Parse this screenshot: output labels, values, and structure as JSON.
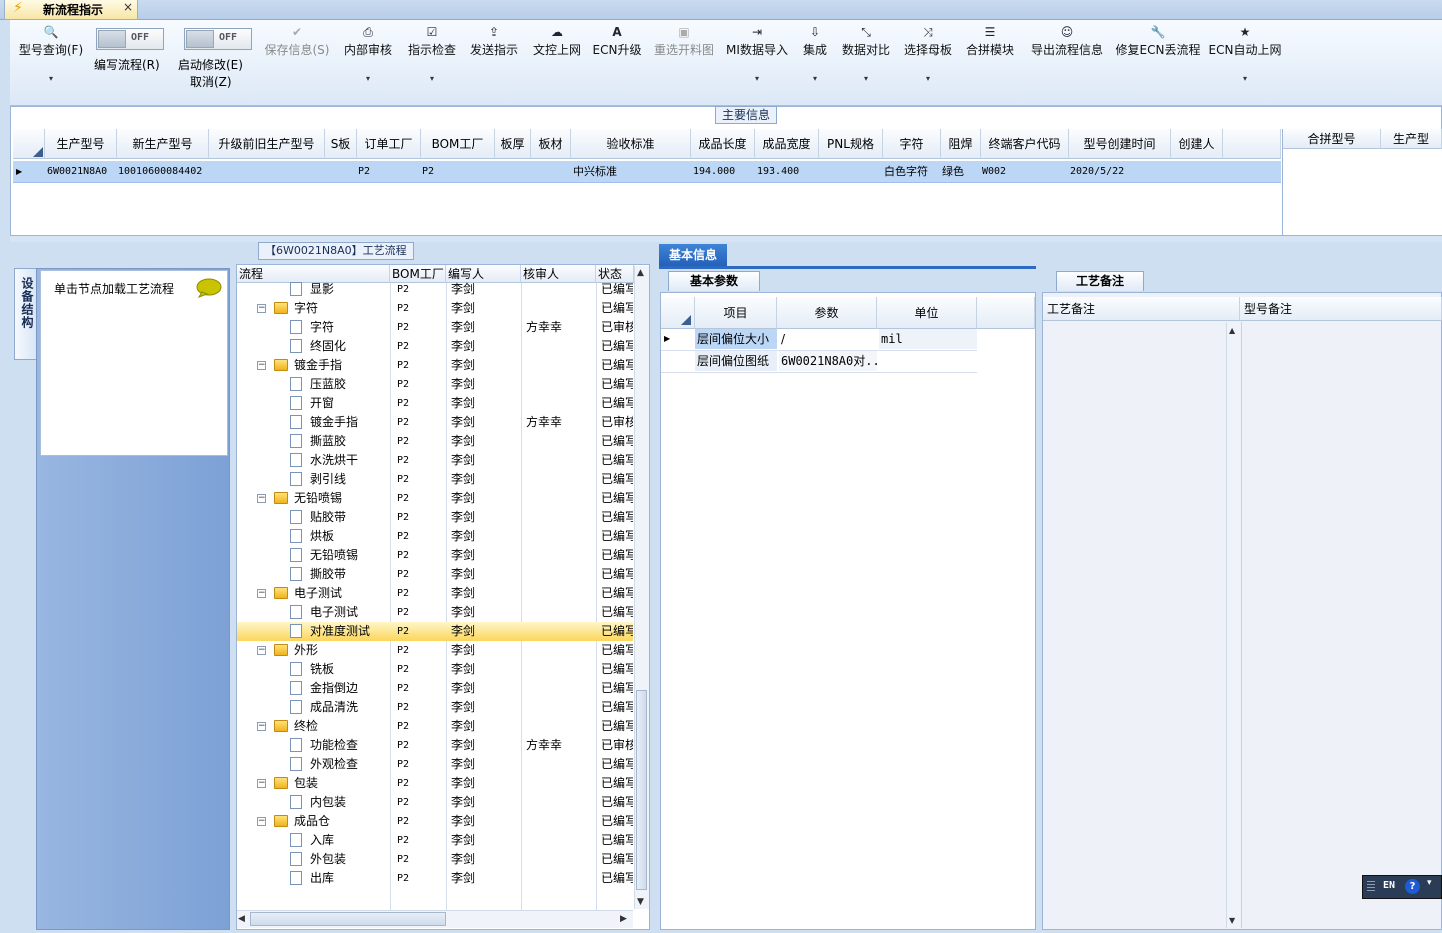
{
  "window": {
    "tab_title": "新流程指示",
    "close_glyph": "×"
  },
  "toolbar": {
    "items": [
      {
        "label": "型号查询(F)",
        "icon": "search-icon",
        "glyph": "🔍"
      },
      {
        "label": "编写流程(R)",
        "toggle": "OFF"
      },
      {
        "label": "启动修改(E)",
        "label2": "取消(Z)",
        "toggle": "OFF"
      },
      {
        "label": "保存信息(S)",
        "icon": "check-icon",
        "glyph": "✔",
        "disabled": true
      },
      {
        "label": "内部审核",
        "icon": "printer-icon",
        "glyph": "⎙"
      },
      {
        "label": "指示检查",
        "icon": "check-box-icon",
        "glyph": "☑"
      },
      {
        "label": "发送指示",
        "icon": "upload-icon",
        "glyph": "⇪"
      },
      {
        "label": "文控上网",
        "icon": "cloud-upload-icon",
        "glyph": "☁"
      },
      {
        "label": "ECN升级",
        "icon": "font-icon",
        "glyph": "A"
      },
      {
        "label": "重选开料图",
        "icon": "image-icon",
        "glyph": "▣",
        "disabled": true
      },
      {
        "label": "MI数据导入",
        "icon": "login-icon",
        "glyph": "⇥"
      },
      {
        "label": "集成",
        "icon": "download-icon",
        "glyph": "⇩"
      },
      {
        "label": "数据对比",
        "icon": "compare-icon",
        "glyph": "⤡"
      },
      {
        "label": "选择母板",
        "icon": "shuffle-icon",
        "glyph": "⤨"
      },
      {
        "label": "合拼模块",
        "icon": "list-icon",
        "glyph": "☰"
      },
      {
        "label": "导出流程信息",
        "icon": "smile-icon",
        "glyph": "☺"
      },
      {
        "label": "修复ECN丢流程",
        "icon": "wrench-icon",
        "glyph": "🔧"
      },
      {
        "label": "ECN自动上网",
        "icon": "star-icon",
        "glyph": "★"
      }
    ]
  },
  "main_info": {
    "caption": "主要信息",
    "columns": [
      "生产型号",
      "新生产型号",
      "升级前旧生产型号",
      "S板",
      "订单工厂",
      "BOM工厂",
      "板厚",
      "板材",
      "验收标准",
      "成品长度",
      "成品宽度",
      "PNL规格",
      "字符",
      "阻焊",
      "终端客户代码",
      "型号创建时间",
      "创建人"
    ],
    "row": {
      "prod_model": "6W0021N8A0",
      "new_model": "10010600084402",
      "order_factory": "P2",
      "bom_factory": "P2",
      "acceptance": "中兴标准",
      "length": "194.000",
      "width": "193.400",
      "char": "白色字符",
      "mask": "绿色",
      "customer": "W002",
      "created": "2020/5/22"
    },
    "side_columns": [
      "合拼型号",
      "生产型"
    ]
  },
  "process_tree": {
    "caption": "【6W0021N8A0】工艺流程",
    "vtab": "设备结构",
    "hint": "单击节点加载工艺流程",
    "columns": [
      "流程",
      "BOM工厂",
      "编写人",
      "核审人",
      "状态"
    ],
    "rows": [
      {
        "name": "显影",
        "level": 1,
        "bom": "P2",
        "writer": "李剑",
        "reviewer": "",
        "status": "已编写"
      },
      {
        "name": "字符",
        "level": 0,
        "bom": "P2",
        "writer": "李剑",
        "reviewer": "",
        "status": "已编写"
      },
      {
        "name": "字符",
        "level": 1,
        "bom": "P2",
        "writer": "李剑",
        "reviewer": "方幸幸",
        "status": "已审核"
      },
      {
        "name": "终固化",
        "level": 1,
        "bom": "P2",
        "writer": "李剑",
        "reviewer": "",
        "status": "已编写"
      },
      {
        "name": "镀金手指",
        "level": 0,
        "bom": "P2",
        "writer": "李剑",
        "reviewer": "",
        "status": "已编写"
      },
      {
        "name": "压蓝胶",
        "level": 1,
        "bom": "P2",
        "writer": "李剑",
        "reviewer": "",
        "status": "已编写"
      },
      {
        "name": "开窗",
        "level": 1,
        "bom": "P2",
        "writer": "李剑",
        "reviewer": "",
        "status": "已编写"
      },
      {
        "name": "镀金手指",
        "level": 1,
        "bom": "P2",
        "writer": "李剑",
        "reviewer": "方幸幸",
        "status": "已审核"
      },
      {
        "name": "撕蓝胶",
        "level": 1,
        "bom": "P2",
        "writer": "李剑",
        "reviewer": "",
        "status": "已编写"
      },
      {
        "name": "水洗烘干",
        "level": 1,
        "bom": "P2",
        "writer": "李剑",
        "reviewer": "",
        "status": "已编写"
      },
      {
        "name": "剥引线",
        "level": 1,
        "bom": "P2",
        "writer": "李剑",
        "reviewer": "",
        "status": "已编写"
      },
      {
        "name": "无铅喷锡",
        "level": 0,
        "bom": "P2",
        "writer": "李剑",
        "reviewer": "",
        "status": "已编写"
      },
      {
        "name": "贴胶带",
        "level": 1,
        "bom": "P2",
        "writer": "李剑",
        "reviewer": "",
        "status": "已编写"
      },
      {
        "name": "烘板",
        "level": 1,
        "bom": "P2",
        "writer": "李剑",
        "reviewer": "",
        "status": "已编写"
      },
      {
        "name": "无铅喷锡",
        "level": 1,
        "bom": "P2",
        "writer": "李剑",
        "reviewer": "",
        "status": "已编写"
      },
      {
        "name": "撕胶带",
        "level": 1,
        "bom": "P2",
        "writer": "李剑",
        "reviewer": "",
        "status": "已编写"
      },
      {
        "name": "电子测试",
        "level": 0,
        "bom": "P2",
        "writer": "李剑",
        "reviewer": "",
        "status": "已编写"
      },
      {
        "name": "电子测试",
        "level": 1,
        "bom": "P2",
        "writer": "李剑",
        "reviewer": "",
        "status": "已编写"
      },
      {
        "name": "对准度测试",
        "level": 1,
        "bom": "P2",
        "writer": "李剑",
        "reviewer": "",
        "status": "已编写",
        "selected": true
      },
      {
        "name": "外形",
        "level": 0,
        "bom": "P2",
        "writer": "李剑",
        "reviewer": "",
        "status": "已编写"
      },
      {
        "name": "铣板",
        "level": 1,
        "bom": "P2",
        "writer": "李剑",
        "reviewer": "",
        "status": "已编写"
      },
      {
        "name": "金指倒边",
        "level": 1,
        "bom": "P2",
        "writer": "李剑",
        "reviewer": "",
        "status": "已编写"
      },
      {
        "name": "成品清洗",
        "level": 1,
        "bom": "P2",
        "writer": "李剑",
        "reviewer": "",
        "status": "已编写"
      },
      {
        "name": "终检",
        "level": 0,
        "bom": "P2",
        "writer": "李剑",
        "reviewer": "",
        "status": "已编写"
      },
      {
        "name": "功能检查",
        "level": 1,
        "bom": "P2",
        "writer": "李剑",
        "reviewer": "方幸幸",
        "status": "已审核"
      },
      {
        "name": "外观检查",
        "level": 1,
        "bom": "P2",
        "writer": "李剑",
        "reviewer": "",
        "status": "已编写"
      },
      {
        "name": "包装",
        "level": 0,
        "bom": "P2",
        "writer": "李剑",
        "reviewer": "",
        "status": "已编写"
      },
      {
        "name": "内包装",
        "level": 1,
        "bom": "P2",
        "writer": "李剑",
        "reviewer": "",
        "status": "已编写"
      },
      {
        "name": "成品仓",
        "level": 0,
        "bom": "P2",
        "writer": "李剑",
        "reviewer": "",
        "status": "已编写"
      },
      {
        "name": "入库",
        "level": 1,
        "bom": "P2",
        "writer": "李剑",
        "reviewer": "",
        "status": "已编写"
      },
      {
        "name": "外包装",
        "level": 1,
        "bom": "P2",
        "writer": "李剑",
        "reviewer": "",
        "status": "已编写"
      },
      {
        "name": "出库",
        "level": 1,
        "bom": "P2",
        "writer": "李剑",
        "reviewer": "",
        "status": "已编写"
      }
    ]
  },
  "basic_info": {
    "tab": "基本信息",
    "subtab": "基本参数",
    "columns": [
      "项目",
      "参数",
      "单位"
    ],
    "rows": [
      {
        "item": "层间偏位大小",
        "param": "/",
        "unit": "mil"
      },
      {
        "item": "层间偏位图纸",
        "param": "6W0021N8A0对...",
        "unit": ""
      }
    ]
  },
  "remarks": {
    "tab": "工艺备注",
    "columns": [
      "工艺备注",
      "型号备注"
    ]
  },
  "langbar": {
    "lang": "EN",
    "help": "?"
  }
}
